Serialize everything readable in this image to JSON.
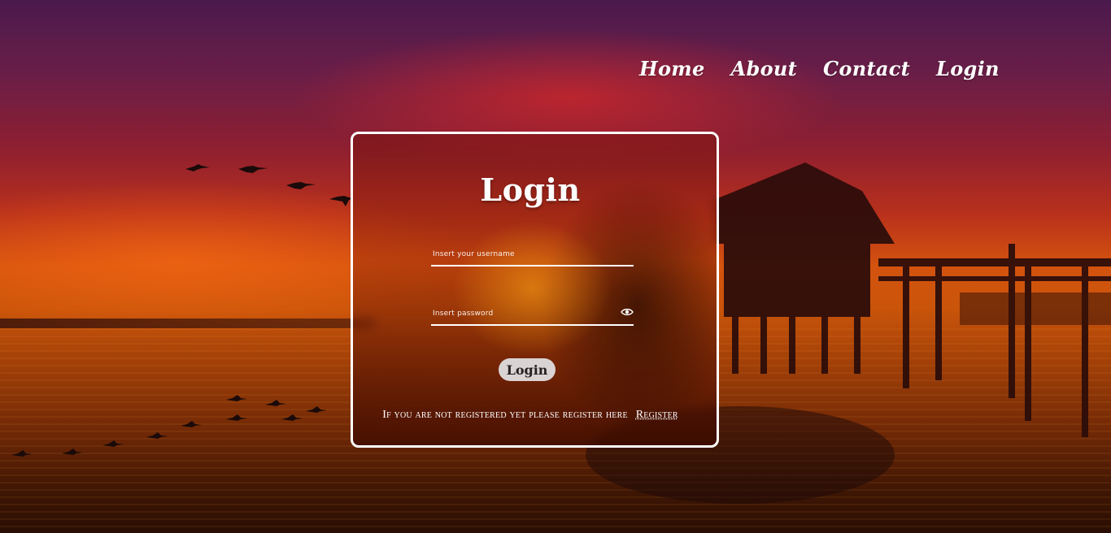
{
  "nav": {
    "items": [
      {
        "label": "Home"
      },
      {
        "label": "About"
      },
      {
        "label": "Contact"
      },
      {
        "label": "Login"
      }
    ]
  },
  "login_card": {
    "title": "Login",
    "username_placeholder": "Insert your username",
    "password_placeholder": "Insert password",
    "password_toggle_icon": "eye-icon",
    "submit_label": "Login",
    "register_prompt": "If you are not registered yet please register here",
    "register_link": "Register",
    "border_color": "#ffffff",
    "button_color": "#d9d3d3"
  }
}
